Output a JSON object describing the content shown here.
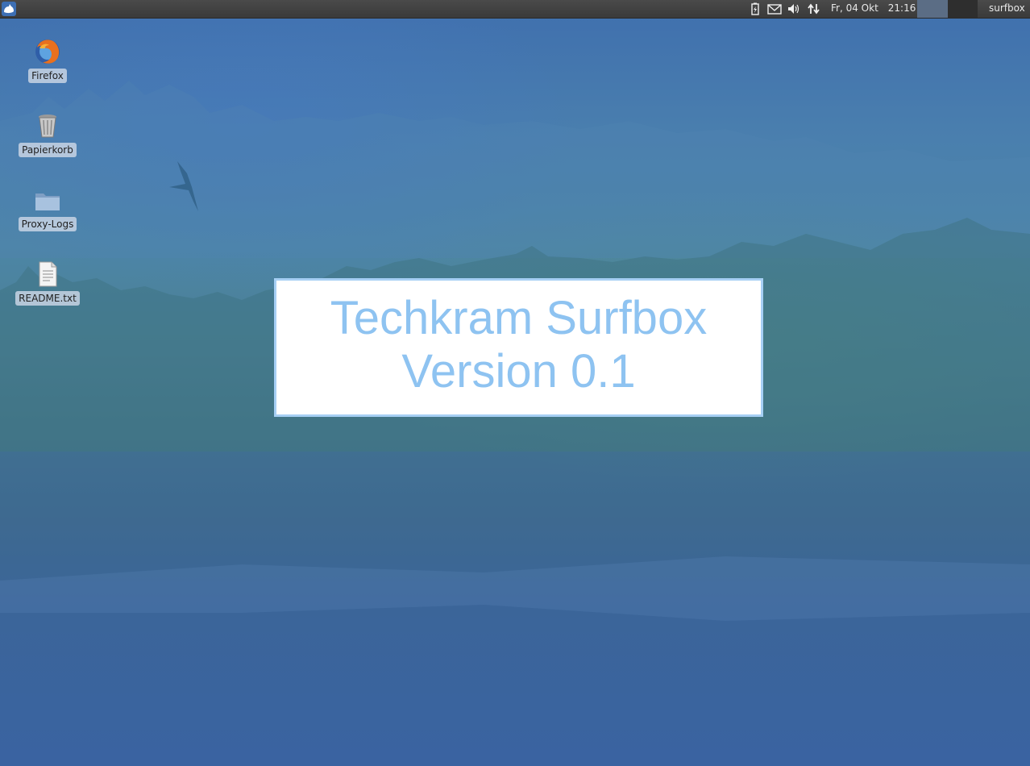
{
  "panel": {
    "menu_icon": "xfce-mouse-icon",
    "tray": {
      "battery_icon": "battery-icon",
      "mail_icon": "mail-icon",
      "volume_icon": "volume-icon",
      "network_icon": "network-updown-icon"
    },
    "clock": {
      "date": "Fr, 04 Okt",
      "time": "21:16"
    },
    "workspaces": [
      "workspace-1",
      "workspace-2"
    ],
    "user": "surfbox"
  },
  "desktop_icons": [
    {
      "label": "Firefox",
      "icon": "firefox-icon"
    },
    {
      "label": "Papierkorb",
      "icon": "trash-icon"
    },
    {
      "label": "Proxy-Logs",
      "icon": "folder-icon"
    },
    {
      "label": "README.txt",
      "icon": "text-file-icon"
    }
  ],
  "splash": {
    "title": "Techkram Surfbox",
    "version": "Version 0.1"
  },
  "colors": {
    "panel_bg": "#3a3a3a",
    "splash_text": "#8ec3f1",
    "splash_border": "#a6cff4",
    "workspace_active": "#5b6d85"
  }
}
